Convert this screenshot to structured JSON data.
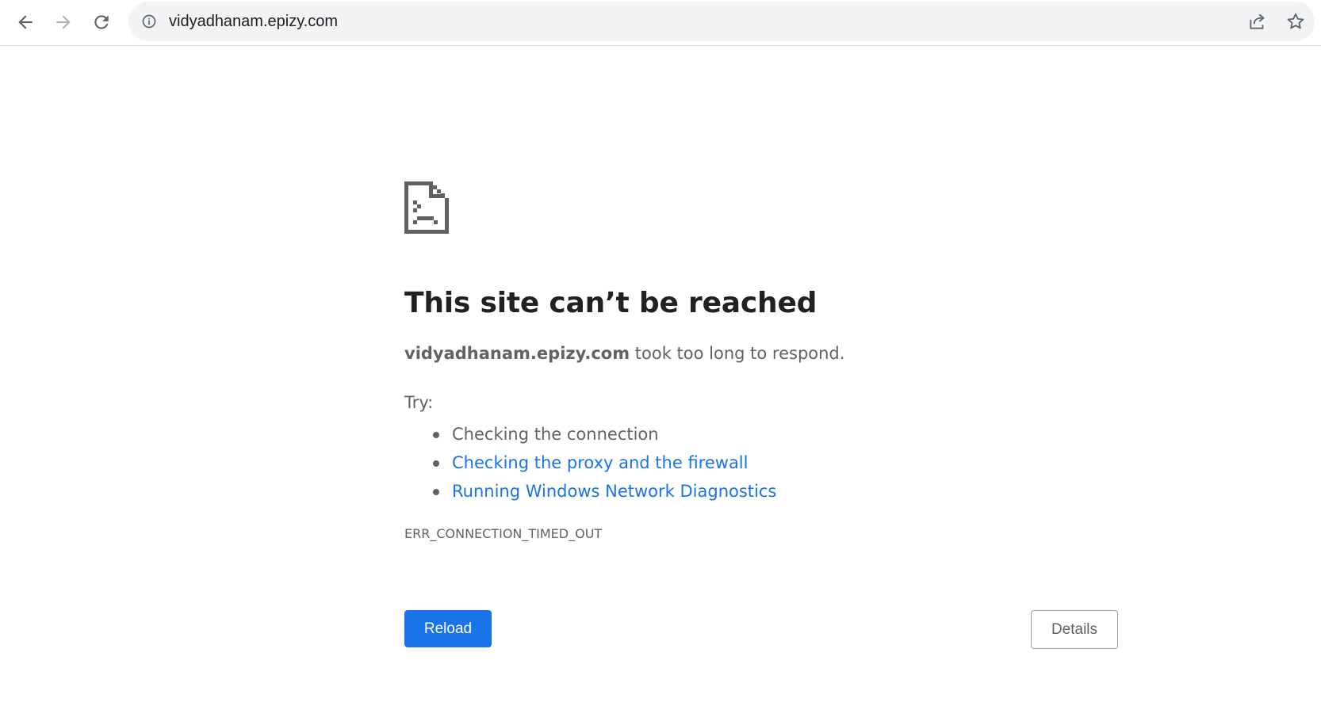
{
  "browser": {
    "url": "vidyadhanam.epizy.com",
    "icons": {
      "back": "arrow-left-icon",
      "forward": "arrow-right-icon",
      "reload": "reload-icon",
      "site_info": "info-icon",
      "share": "share-icon",
      "bookmark": "star-icon"
    }
  },
  "error_page": {
    "icon": "sad-page-icon",
    "heading": "This site can’t be reached",
    "host": "vidyadhanam.epizy.com",
    "message": " took too long to respond.",
    "try_label": "Try:",
    "suggestions": [
      {
        "text": "Checking the connection",
        "link": false
      },
      {
        "text": "Checking the proxy and the firewall",
        "link": true
      },
      {
        "text": "Running Windows Network Diagnostics",
        "link": true
      }
    ],
    "error_code": "ERR_CONNECTION_TIMED_OUT",
    "reload_label": "Reload",
    "details_label": "Details"
  },
  "colors": {
    "accent": "#1a73e8",
    "text": "#202124",
    "secondary_text": "#5f6368",
    "omnibox_bg": "#f1f3f4"
  }
}
